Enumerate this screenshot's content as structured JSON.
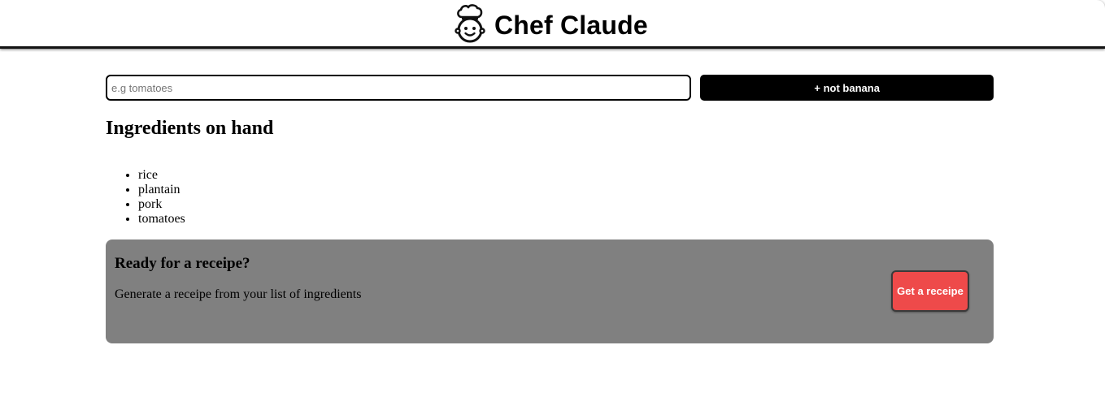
{
  "header": {
    "title": "Chef Claude",
    "icon": "chef-hat-face-icon"
  },
  "form": {
    "input_placeholder": "e.g tomatoes",
    "input_value": "",
    "add_button_label": "+ not banana"
  },
  "ingredients": {
    "heading": "Ingredients on hand",
    "items": [
      "rice",
      "plantain",
      "pork",
      "tomatoes"
    ]
  },
  "recipe_cta": {
    "heading": "Ready for a receipe?",
    "text": "Generate a receipe from your list of ingredients",
    "button_label": "Get a receipe",
    "button_color": "#ee4a4a",
    "panel_color": "#808080"
  }
}
